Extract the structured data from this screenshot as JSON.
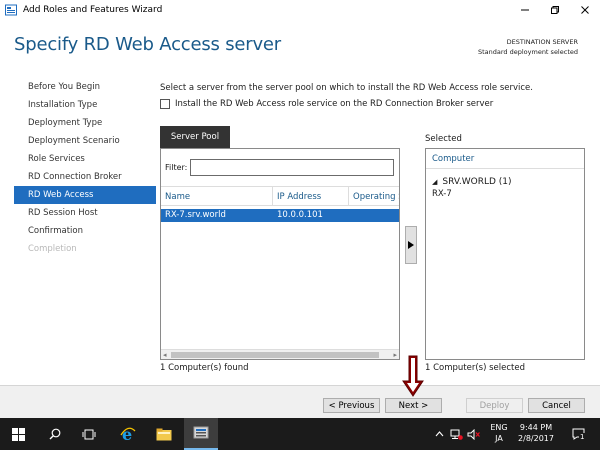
{
  "window": {
    "title": "Add Roles and Features Wizard"
  },
  "header": {
    "page_title": "Specify RD Web Access server",
    "destination_label": "DESTINATION SERVER",
    "destination_value": "Standard deployment selected"
  },
  "nav": {
    "items": [
      {
        "label": "Before You Begin",
        "state": "normal"
      },
      {
        "label": "Installation Type",
        "state": "normal"
      },
      {
        "label": "Deployment Type",
        "state": "normal"
      },
      {
        "label": "Deployment Scenario",
        "state": "normal"
      },
      {
        "label": "Role Services",
        "state": "normal"
      },
      {
        "label": "RD Connection Broker",
        "state": "normal"
      },
      {
        "label": "RD Web Access",
        "state": "active"
      },
      {
        "label": "RD Session Host",
        "state": "normal"
      },
      {
        "label": "Confirmation",
        "state": "normal"
      },
      {
        "label": "Completion",
        "state": "disabled"
      }
    ]
  },
  "content": {
    "instruction": "Select a server from the server pool on which to install the RD Web Access role service.",
    "checkbox_label": "Install the RD Web Access role service on the RD Connection Broker server",
    "checkbox_checked": false
  },
  "server_pool": {
    "tab_label": "Server Pool",
    "filter_label": "Filter:",
    "filter_value": "",
    "columns": [
      "Name",
      "IP Address",
      "Operating S"
    ],
    "rows": [
      {
        "name": "RX-7.srv.world",
        "ip": "10.0.0.101",
        "os": "",
        "selected": true
      }
    ],
    "status": "1 Computer(s) found"
  },
  "selected": {
    "label": "Selected",
    "column": "Computer",
    "group": "SRV.WORLD (1)",
    "server": "RX-7",
    "status": "1 Computer(s) selected"
  },
  "footer": {
    "previous_label": "< Previous",
    "next_label": "Next >",
    "deploy_label": "Deploy",
    "cancel_label": "Cancel"
  },
  "taskbar": {
    "lang_1": "ENG",
    "lang_2": "JA",
    "time": "9:44 PM",
    "date": "2/8/2017",
    "notification_count": "1"
  },
  "colors": {
    "accent": "#1f6dbf",
    "title_blue": "#1a5a8a",
    "annotation_arrow": "#8b0000"
  }
}
